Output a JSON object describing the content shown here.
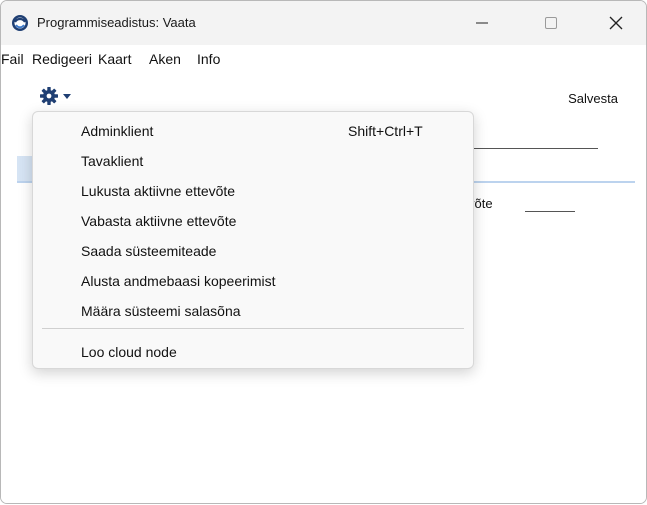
{
  "window": {
    "title": "Programmiseadistus: Vaata",
    "minimize_glyph": "—",
    "maximize_glyph": "☐",
    "close_glyph": "✕"
  },
  "menubar": {
    "items": [
      "Fail",
      "Redigeeri",
      "Kaart",
      "Aken",
      "Info"
    ]
  },
  "toolbar": {
    "operations_icon": "gear-icon",
    "save_label": "Salvesta"
  },
  "form": {
    "partial_label": "võte"
  },
  "operations_menu": {
    "items": [
      {
        "label": "Adminklient",
        "shortcut": "Shift+Ctrl+T"
      },
      {
        "label": "Tavaklient",
        "shortcut": ""
      },
      {
        "label": "Lukusta aktiivne ettevõte",
        "shortcut": ""
      },
      {
        "label": "Vabasta aktiivne ettevõte",
        "shortcut": ""
      },
      {
        "label": "Saada süsteemiteade",
        "shortcut": ""
      },
      {
        "label": "Alusta andmebaasi kopeerimist",
        "shortcut": ""
      },
      {
        "label": "Määra süsteemi salasõna",
        "shortcut": ""
      },
      {
        "label": "Loo cloud node",
        "shortcut": ""
      }
    ]
  }
}
